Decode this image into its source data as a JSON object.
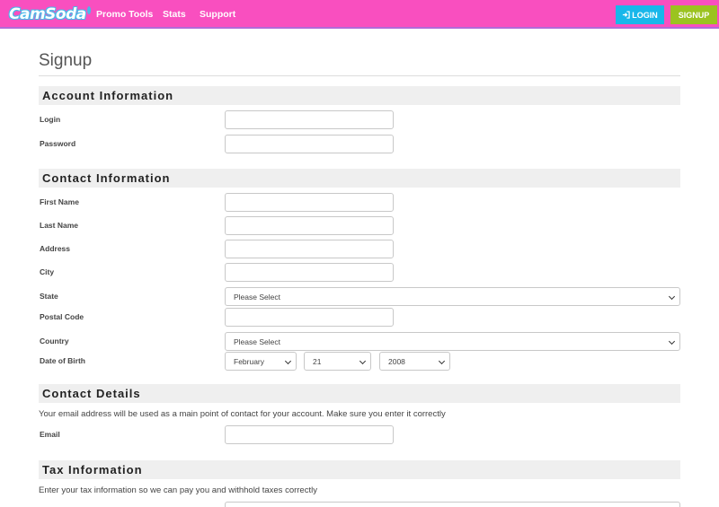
{
  "header": {
    "logo": "CamSoda",
    "nav": [
      "Promo Tools",
      "Stats",
      "Support"
    ],
    "login_label": "LOGIN",
    "signup_label": "SIGNUP"
  },
  "page": {
    "title": "Signup"
  },
  "account": {
    "title": "Account Information",
    "login_label": "Login",
    "password_label": "Password"
  },
  "contact": {
    "title": "Contact Information",
    "first_name_label": "First Name",
    "last_name_label": "Last Name",
    "address_label": "Address",
    "city_label": "City",
    "state_label": "State",
    "state_value": "Please Select",
    "postal_label": "Postal Code",
    "country_label": "Country",
    "country_value": "Please Select",
    "dob_label": "Date of Birth",
    "dob_month": "February",
    "dob_day": "21",
    "dob_year": "2008"
  },
  "details": {
    "title": "Contact Details",
    "note": "Your email address will be used as a main point of contact for your account. Make sure you enter it correctly",
    "email_label": "Email"
  },
  "tax": {
    "title": "Tax Information",
    "note": "Enter your tax information so we can pay you and withhold taxes correctly"
  },
  "colors": {
    "nav_bg": "#f94fbf",
    "login_bg": "#18b7ea",
    "signup_bg": "#9bc320"
  }
}
